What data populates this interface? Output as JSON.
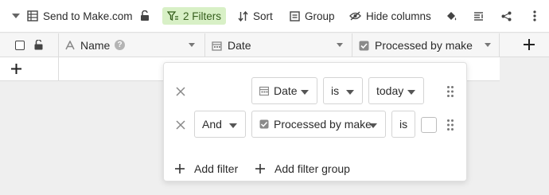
{
  "toolbar": {
    "view_name": "Send to Make.com",
    "filters_label": "2 Filters",
    "sort_label": "Sort",
    "group_label": "Group",
    "hide_columns_label": "Hide columns"
  },
  "columns": [
    {
      "label": "Name"
    },
    {
      "label": "Date"
    },
    {
      "label": "Processed by make"
    }
  ],
  "filters": {
    "rows": [
      {
        "field": "Date",
        "operator": "is",
        "value": "today"
      },
      {
        "conjunction": "And",
        "field": "Processed by make",
        "operator": "is",
        "value_checked": false
      }
    ],
    "add_filter_label": "Add filter",
    "add_filter_group_label": "Add filter group"
  },
  "colors": {
    "accent_green_bg": "#d8f0c6",
    "accent_green_text": "#365f1d"
  }
}
